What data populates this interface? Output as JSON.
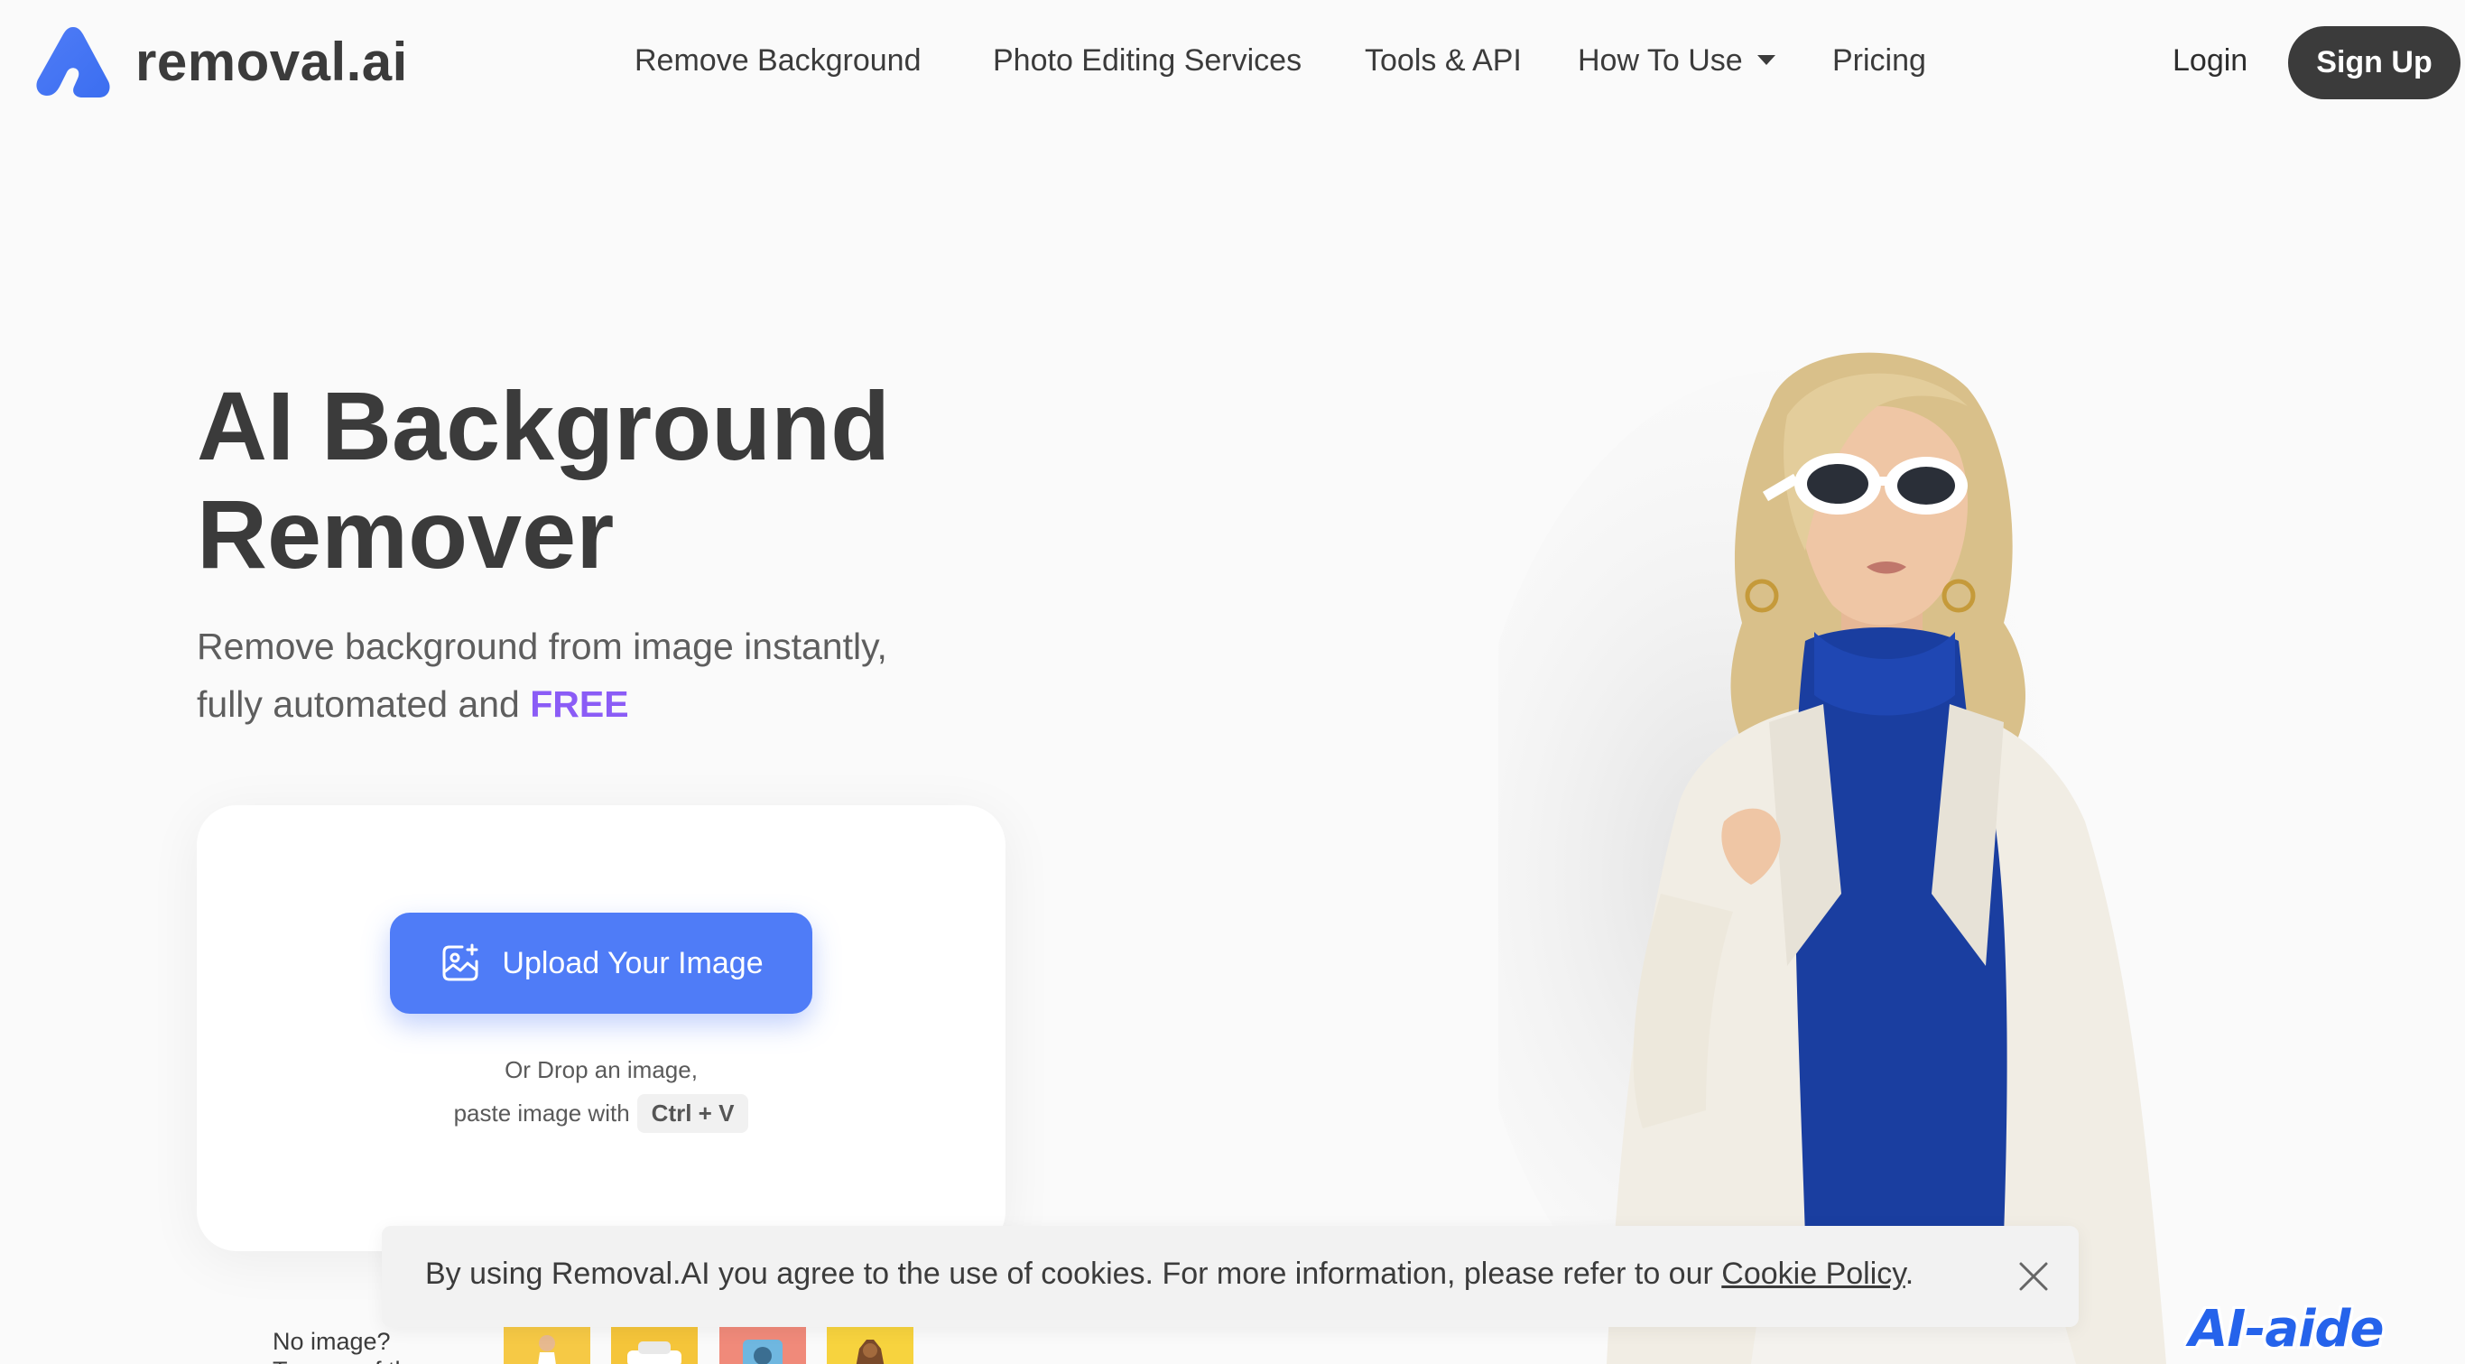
{
  "header": {
    "logo_text": "removal.ai",
    "nav": [
      {
        "label": "Remove Background"
      },
      {
        "label": "Photo Editing Services"
      },
      {
        "label": "Tools & API"
      },
      {
        "label": "How To Use",
        "has_dropdown": true
      },
      {
        "label": "Pricing"
      }
    ],
    "login_label": "Login",
    "signup_label": "Sign Up"
  },
  "hero": {
    "title_line1": "AI Background",
    "title_line2": "Remover",
    "subtitle_line1": "Remove background from image instantly,",
    "subtitle_line2_prefix": "fully automated and ",
    "subtitle_highlight": "FREE"
  },
  "upload": {
    "button_label": "Upload Your Image",
    "drop_text": "Or Drop an image,",
    "paste_text": "paste image with",
    "shortcut": "Ctrl + V"
  },
  "samples": {
    "no_image_text": "No image?",
    "no_image_text2": "Try one of these"
  },
  "cookie": {
    "text": "By using Removal.AI you agree to the use of cookies. For more information, please refer to our ",
    "link_label": "Cookie Policy",
    "suffix": "."
  },
  "watermark": "AI-aide",
  "colors": {
    "accent": "#4f7cf7",
    "highlight": "#8b5cf6",
    "dark": "#3b3b3b",
    "background": "#fafafa"
  }
}
